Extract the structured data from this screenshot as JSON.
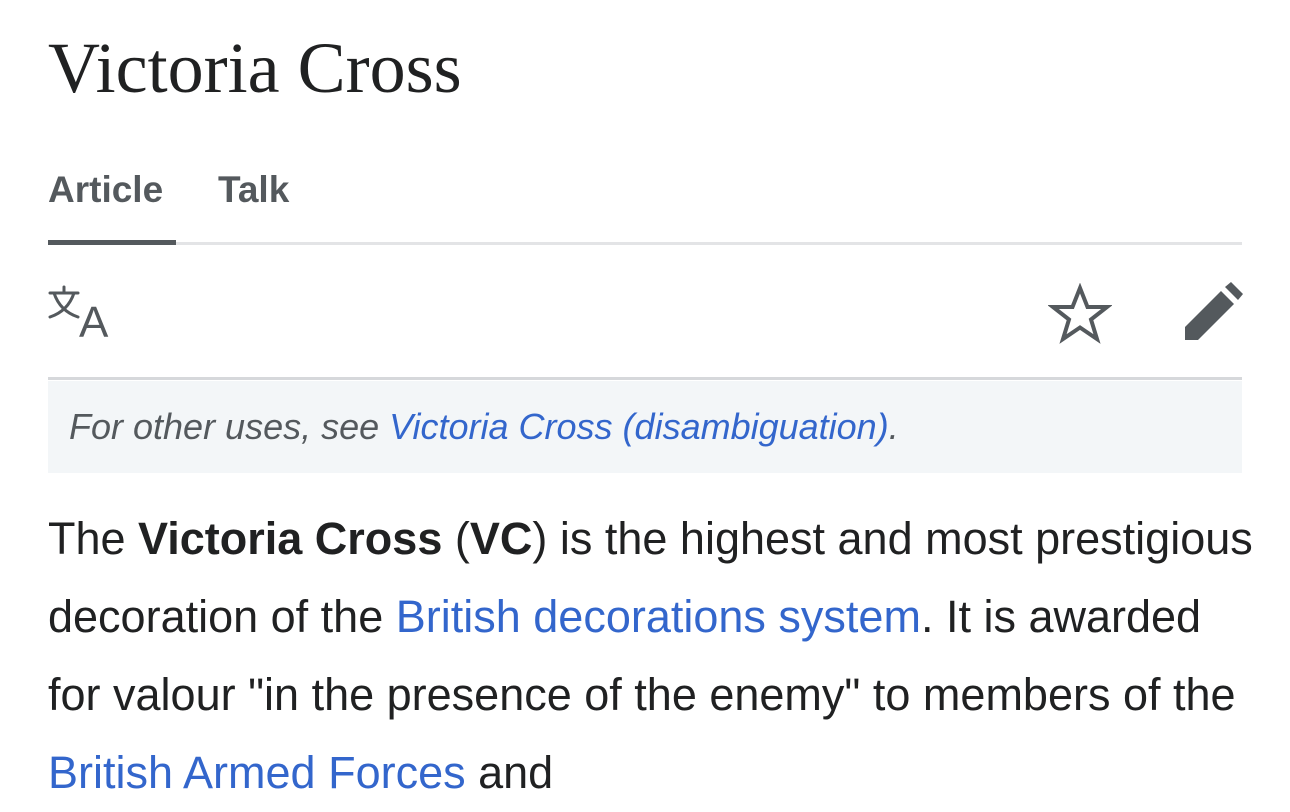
{
  "article": {
    "title": "Victoria Cross"
  },
  "tabs": [
    {
      "label": "Article",
      "selected": true
    },
    {
      "label": "Talk",
      "selected": false
    }
  ],
  "toolbar": {
    "language_icon": "language-icon",
    "watch_icon": "star-outline-icon",
    "edit_icon": "pencil-icon"
  },
  "hatnote": {
    "prefix": "For other uses, see ",
    "link": "Victoria Cross (disambiguation)",
    "suffix": "."
  },
  "lead": {
    "t1": "The ",
    "b1": "Victoria Cross",
    "t2": " (",
    "b2": "VC",
    "t3": ") is the highest and most prestigious decoration of the ",
    "link1": "British decorations system",
    "t4": ". It is awarded for valour \"in the presence of the enemy\" to members of the ",
    "link2": "British Armed Forces",
    "t5": " and"
  },
  "colors": {
    "text": "#202122",
    "secondary_text": "#54595d",
    "link": "#3366cc",
    "hatnote_bg": "#f3f6f8",
    "divider": "#e3e4e6"
  }
}
